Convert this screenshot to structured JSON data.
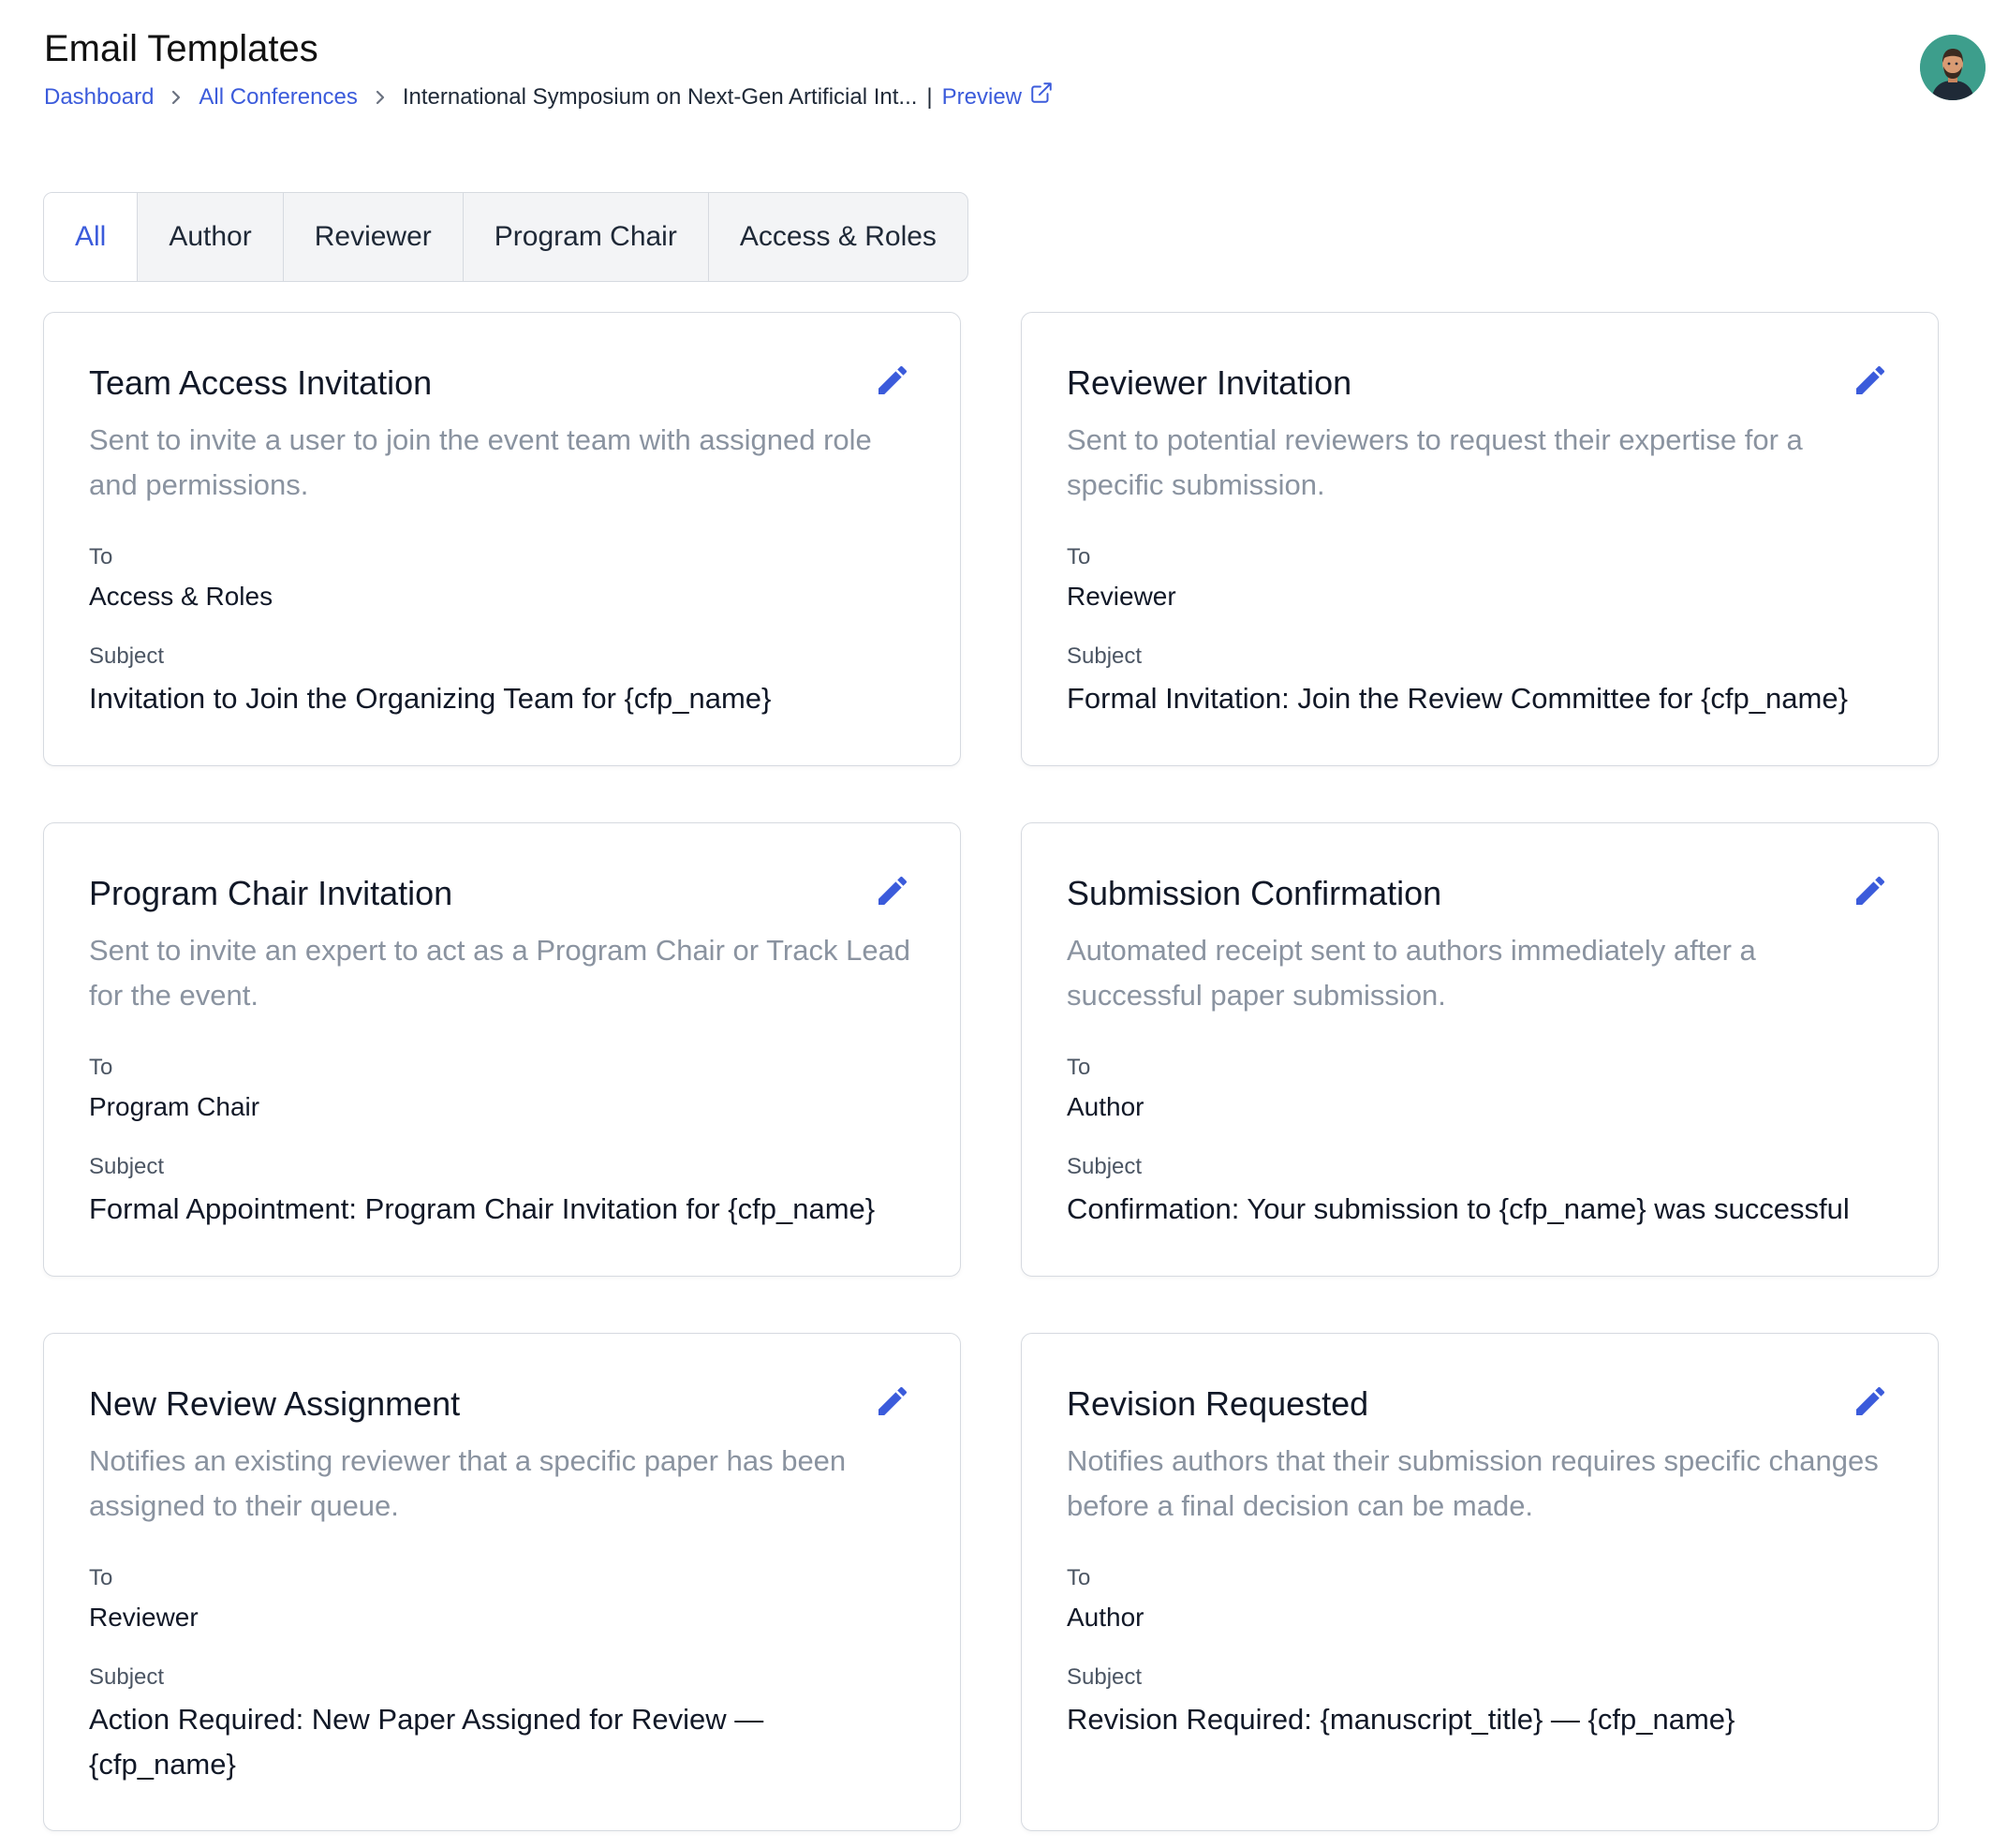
{
  "header": {
    "title": "Email Templates",
    "breadcrumb": {
      "dashboard": "Dashboard",
      "all_conferences": "All Conferences",
      "current": "International Symposium on Next-Gen Artificial Int...",
      "divider": "|",
      "preview": "Preview"
    }
  },
  "tabs": [
    {
      "label": "All",
      "active": true
    },
    {
      "label": "Author",
      "active": false
    },
    {
      "label": "Reviewer",
      "active": false
    },
    {
      "label": "Program Chair",
      "active": false
    },
    {
      "label": "Access & Roles",
      "active": false
    }
  ],
  "field_labels": {
    "to": "To",
    "subject": "Subject"
  },
  "cards": [
    {
      "title": "Team Access Invitation",
      "description": "Sent to invite a user to join the event team with assigned role and permissions.",
      "to": "Access & Roles",
      "subject": "Invitation to Join the Organizing Team for {cfp_name}"
    },
    {
      "title": "Reviewer Invitation",
      "description": "Sent to potential reviewers to request their expertise for a specific submission.",
      "to": "Reviewer",
      "subject": "Formal Invitation: Join the Review Committee for {cfp_name}"
    },
    {
      "title": "Program Chair Invitation",
      "description": "Sent to invite an expert to act as a Program Chair or Track Lead for the event.",
      "to": "Program Chair",
      "subject": "Formal Appointment: Program Chair Invitation for {cfp_name}"
    },
    {
      "title": "Submission Confirmation",
      "description": "Automated receipt sent to authors immediately after a successful paper submission.",
      "to": "Author",
      "subject": "Confirmation: Your submission to {cfp_name} was successful"
    },
    {
      "title": "New Review Assignment",
      "description": "Notifies an existing reviewer that a specific paper has been assigned to their queue.",
      "to": "Reviewer",
      "subject": "Action Required: New Paper Assigned for Review — {cfp_name}"
    },
    {
      "title": "Revision Requested",
      "description": "Notifies authors that their submission requires specific changes before a final decision can be made.",
      "to": "Author",
      "subject": "Revision Required: {manuscript_title} — {cfp_name}"
    }
  ],
  "colors": {
    "accent": "#3b5bdb",
    "muted": "#8a93a0",
    "border": "#d6dae0"
  },
  "icons": {
    "edit": "pencil-icon",
    "preview": "external-link-icon",
    "separator": "chevron-right-icon"
  }
}
